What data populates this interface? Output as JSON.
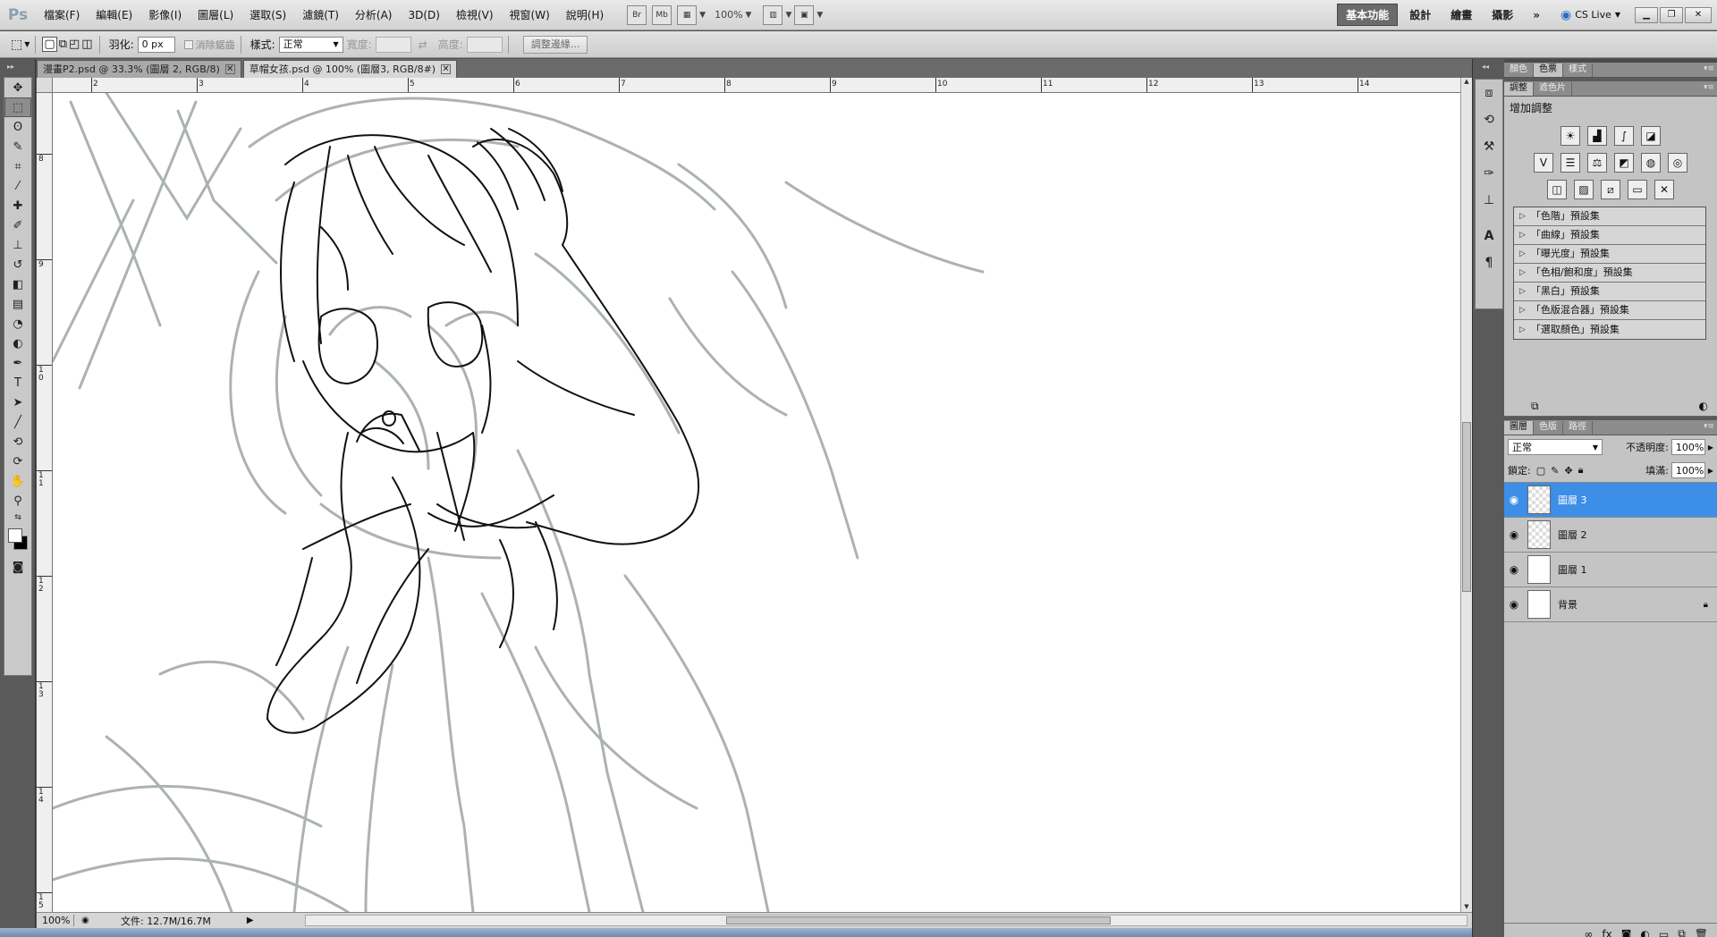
{
  "app": {
    "logo": "Ps"
  },
  "menu": [
    "檔案(F)",
    "編輯(E)",
    "影像(I)",
    "圖層(L)",
    "選取(S)",
    "濾鏡(T)",
    "分析(A)",
    "3D(D)",
    "檢視(V)",
    "視窗(W)",
    "說明(H)"
  ],
  "menubar_buttons": {
    "bridge": "Br",
    "minibridge": "Mb"
  },
  "zoom_dropdown": "100%",
  "workspaces": [
    "基本功能",
    "設計",
    "繪畫",
    "攝影"
  ],
  "workspace_more": "»",
  "cs_live": "CS Live",
  "options": {
    "feather_label": "羽化:",
    "feather_value": "0 px",
    "antialias_label": "消除鋸齒",
    "style_label": "樣式:",
    "style_value": "正常",
    "width_label": "寬度:",
    "height_label": "高度:",
    "refine_button": "調整邊緣..."
  },
  "tabs": [
    {
      "label": "漫畫P2.psd @ 33.3% (圖層 2, RGB/8)",
      "active": false
    },
    {
      "label": "草帽女孩.psd @ 100% (圖層3, RGB/8#)",
      "active": true
    }
  ],
  "ruler_top": [
    "2",
    "3",
    "4",
    "5",
    "6",
    "7",
    "8",
    "9",
    "10",
    "11",
    "12",
    "13",
    "14"
  ],
  "ruler_left": [
    "8",
    "9",
    "1 0",
    "1 1",
    "1 2",
    "1 3",
    "1 4",
    "1 5"
  ],
  "status": {
    "zoom": "100%",
    "doc": "文件: 12.7M/16.7M"
  },
  "panels": {
    "top_tabs": [
      "顏色",
      "色票",
      "樣式"
    ],
    "adj_tabs": [
      "調整",
      "遮色片"
    ],
    "adj_title": "增加調整",
    "presets": [
      "「色階」預設集",
      "「曲線」預設集",
      "「曝光度」預設集",
      "「色相/飽和度」預設集",
      "「黑白」預設集",
      "「色版混合器」預設集",
      "「選取顏色」預設集"
    ],
    "layer_tabs": [
      "圖層",
      "色版",
      "路徑"
    ],
    "blend_mode": "正常",
    "opacity_label": "不透明度:",
    "opacity_value": "100%",
    "lock_label": "鎖定:",
    "fill_label": "填滿:",
    "fill_value": "100%",
    "layers": [
      {
        "name": "圖層 3",
        "selected": true
      },
      {
        "name": "圖層 2",
        "selected": false
      },
      {
        "name": "圖層 1",
        "selected": false
      },
      {
        "name": "背景",
        "selected": false
      }
    ]
  }
}
